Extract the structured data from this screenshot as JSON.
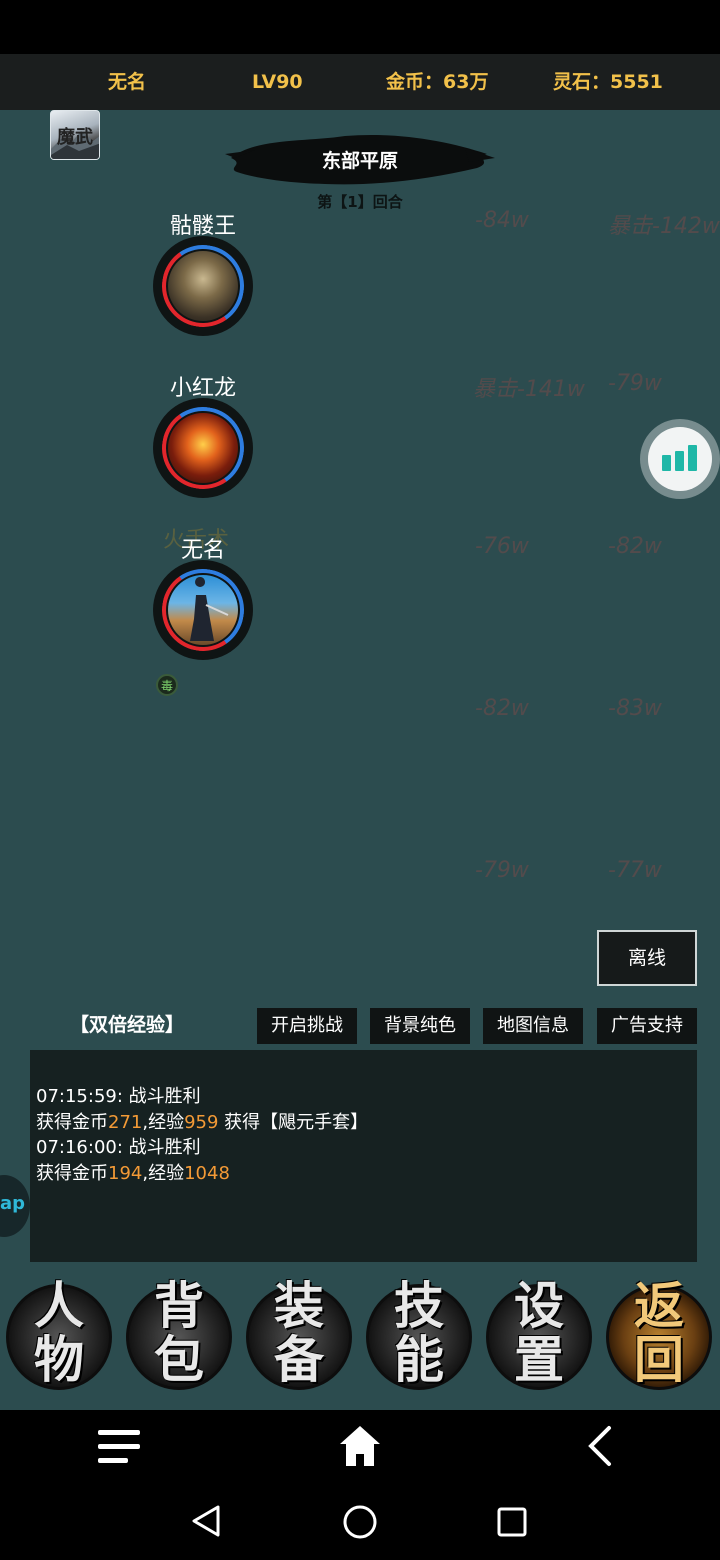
{
  "header": {
    "player_name": "无名",
    "level": "LV90",
    "gold": "金币：63万",
    "spirit_stone": "灵石：5551"
  },
  "battle": {
    "map_name": "东部平原",
    "round": "第【1】回合",
    "units": [
      {
        "name": "骷髅王"
      },
      {
        "name": "小红龙"
      },
      {
        "name": "无名"
      }
    ],
    "skill_float": "火舌术",
    "status_badge": "毒",
    "damage_numbers": [
      [
        "-84w",
        "暴击-142w"
      ],
      [
        "暴击-141w",
        "-79w"
      ],
      [
        "-76w",
        "-82w"
      ],
      [
        "-82w",
        "-83w"
      ],
      [
        "-79w",
        "-77w"
      ]
    ]
  },
  "buttons": {
    "offline": "离线",
    "double_exp": "【双倍经验】",
    "challenge": "开启挑战",
    "solid_bg": "背景纯色",
    "map_info": "地图信息",
    "ad_support": "广告支持"
  },
  "log": {
    "lines": [
      {
        "time": "07:15:59:",
        "msg": "战斗胜利"
      },
      {
        "prefix": "获得金币",
        "gold": "271",
        "mid": ",经验",
        "exp": "959",
        "suffix": " 获得【飓元手套】"
      },
      {
        "time": "07:16:00:",
        "msg": "战斗胜利"
      },
      {
        "prefix": "获得金币",
        "gold": "194",
        "mid": ",经验",
        "exp": "1048",
        "suffix": ""
      }
    ]
  },
  "side_tab": "ap",
  "skill_bar": [
    {
      "top": "人",
      "bottom": "物"
    },
    {
      "top": "背",
      "bottom": "包"
    },
    {
      "top": "装",
      "bottom": "备"
    },
    {
      "top": "技",
      "bottom": "能"
    },
    {
      "top": "设",
      "bottom": "置"
    },
    {
      "top": "返",
      "bottom": "回"
    }
  ],
  "logo_text": "魔武"
}
